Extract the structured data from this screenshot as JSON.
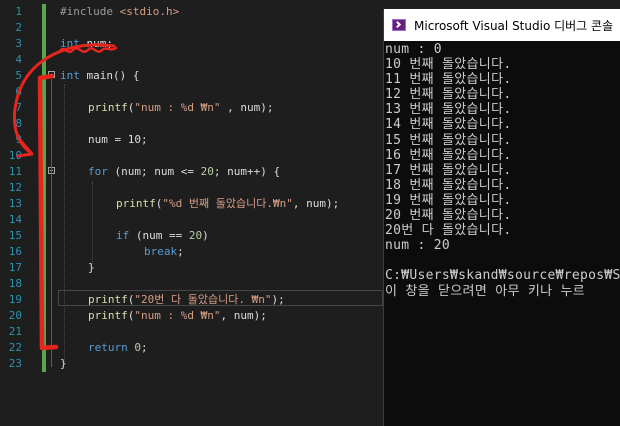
{
  "editor": {
    "line_numbers": [
      "1",
      "2",
      "3",
      "4",
      "5",
      "6",
      "7",
      "8",
      "9",
      "10",
      "11",
      "12",
      "13",
      "14",
      "15",
      "16",
      "17",
      "18",
      "19",
      "20",
      "21",
      "22",
      "23"
    ],
    "lines": {
      "l1": {
        "kw": "#include",
        "rest": " <stdio.h>"
      },
      "l3": {
        "kw": "int",
        "rest": " num;"
      },
      "l5": {
        "kw": "int",
        "rest": " main() {"
      },
      "l7": {
        "fn": "printf",
        "a": "(",
        "s": "\"num : %d ₩n\"",
        "b": " , num);"
      },
      "l9": {
        "text": "num = 10;"
      },
      "l11": {
        "kw": "for",
        "a": " (num; num <= ",
        "n": "20",
        "b": "; num++) {"
      },
      "l13": {
        "fn": "printf",
        "a": "(",
        "s": "\"%d 번째 돌았습니다.₩n\"",
        "b": ", num);"
      },
      "l15": {
        "kw": "if",
        "a": " (num == ",
        "n": "20",
        "b": ")"
      },
      "l16": {
        "kw": "break",
        "b": ";"
      },
      "l17": {
        "text": "}"
      },
      "l19": {
        "fn": "printf",
        "a": "(",
        "s": "\"20번 다 돌았습니다. ₩n\"",
        "b": ");"
      },
      "l20": {
        "fn": "printf",
        "a": "(",
        "s": "\"num : %d ₩n\"",
        "b": ", num);"
      },
      "l22": {
        "kw": "return",
        "a": " ",
        "n": "0",
        "b": ";"
      },
      "l23": {
        "text": "}"
      }
    }
  },
  "console": {
    "title": "Microsoft Visual Studio 디버그 콘솔",
    "lines": [
      "num : 0",
      "10 번째 돌았습니다.",
      "11 번째 돌았습니다.",
      "12 번째 돌았습니다.",
      "13 번째 돌았습니다.",
      "14 번째 돌았습니다.",
      "15 번째 돌았습니다.",
      "16 번째 돌았습니다.",
      "17 번째 돌았습니다.",
      "18 번째 돌았습니다.",
      "19 번째 돌았습니다.",
      "20 번째 돌았습니다.",
      "20번 다 돌았습니다.",
      "num : 20",
      "",
      "C:₩Users₩skand₩source₩repos₩St",
      "이 창을 닫으려면 아무 키나 누르"
    ]
  },
  "colors": {
    "editor_bg": "#1e1e1e",
    "line_number": "#2b91af",
    "keyword": "#569cd6",
    "string": "#d69d85",
    "change_bar": "#57a64a",
    "annotation": "#e8251d",
    "console_bg": "#0c0c0c",
    "console_text": "#cccccc"
  }
}
